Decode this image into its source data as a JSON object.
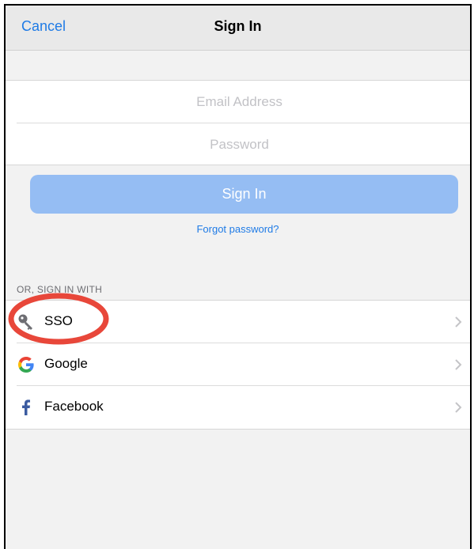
{
  "navbar": {
    "cancel_label": "Cancel",
    "title": "Sign In"
  },
  "form": {
    "email_placeholder": "Email Address",
    "password_placeholder": "Password",
    "email_value": "",
    "password_value": "",
    "signin_label": "Sign In",
    "forgot_label": "Forgot password?"
  },
  "alt_signin": {
    "section_label": "OR, SIGN IN WITH",
    "items": [
      {
        "label": "SSO",
        "icon": "key-icon"
      },
      {
        "label": "Google",
        "icon": "google-icon"
      },
      {
        "label": "Facebook",
        "icon": "facebook-icon"
      }
    ]
  },
  "colors": {
    "accent": "#1f7be6",
    "button_disabled": "#95bdf3",
    "annotation": "#e8473a"
  }
}
